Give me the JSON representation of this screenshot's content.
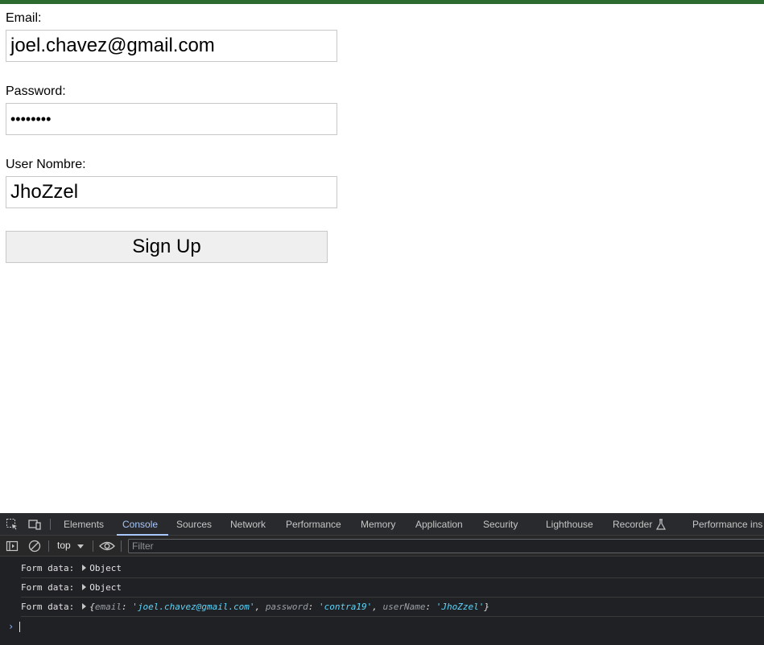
{
  "colors": {
    "top_bar": "#2d6a2f",
    "devtools_bg": "#202124",
    "active_tab": "#a8c7fa",
    "string_value": "#5cd5fb"
  },
  "form": {
    "email_label": "Email:",
    "email_value": "joel.chavez@gmail.com",
    "password_label": "Password:",
    "password_value": "••••••••",
    "username_label": "User Nombre:",
    "username_value": "JhoZzel",
    "signup_label": "Sign Up"
  },
  "devtools": {
    "tabs": [
      "Elements",
      "Console",
      "Sources",
      "Network",
      "Performance",
      "Memory",
      "Application",
      "Security",
      "Lighthouse",
      "Recorder",
      "Performance ins"
    ],
    "active_tab": "Console",
    "context": "top",
    "filter_placeholder": "Filter",
    "icons": [
      "inspect-icon",
      "device-toggle-icon",
      "sidebar-icon",
      "clear-console-icon",
      "dropdown-arrow-icon",
      "eye-icon",
      "flask-icon",
      "chevron-right-icon"
    ],
    "logs": [
      {
        "label": "Form data:",
        "summary": "Object"
      },
      {
        "label": "Form data:",
        "summary": "Object"
      },
      {
        "label": "Form data:",
        "open": "{",
        "k1": "email",
        "v1": "'joel.chavez@gmail.com'",
        "k2": "password",
        "v2": "'contra19'",
        "k3": "userName",
        "v3": "'JhoZzel'",
        "close": "}"
      }
    ]
  }
}
